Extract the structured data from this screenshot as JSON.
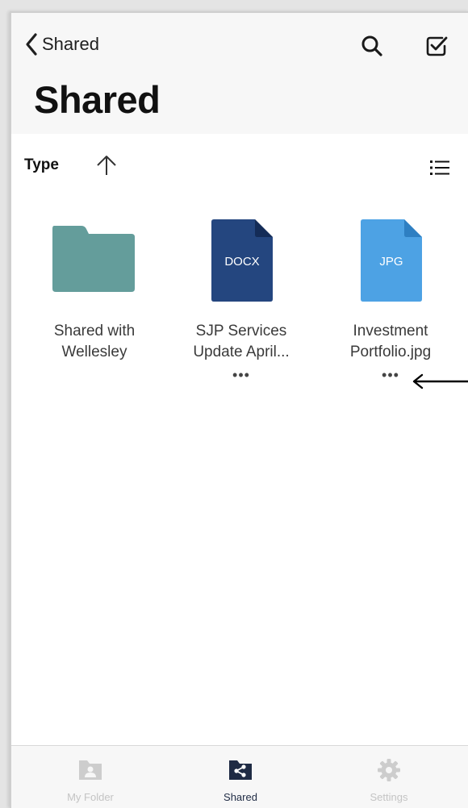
{
  "nav": {
    "back_label": "Shared",
    "title": "Shared"
  },
  "sort": {
    "label": "Type",
    "direction": "ascending"
  },
  "files": [
    {
      "kind": "folder",
      "name_line1": "Shared with",
      "name_line2": "Wellesley",
      "color": "#649d9b"
    },
    {
      "kind": "docx",
      "type_label": "DOCX",
      "name_line1": "SJP Services",
      "name_line2": "Update April...",
      "more": "•••",
      "color": "#24467f"
    },
    {
      "kind": "jpg",
      "type_label": "JPG",
      "name_line1": "Investment",
      "name_line2": "Portfolio.jpg",
      "more": "•••",
      "color": "#4da2e4"
    }
  ],
  "tabbar": {
    "tabs": [
      {
        "label": "My Folder",
        "icon": "folder-person-icon",
        "active": false
      },
      {
        "label": "Shared",
        "icon": "share-icon",
        "active": true
      },
      {
        "label": "Settings",
        "icon": "gear-icon",
        "active": false
      }
    ]
  },
  "colors": {
    "accent": "#1f2b44",
    "inactive": "#c4c4c4",
    "header_bg": "#f7f7f7"
  }
}
